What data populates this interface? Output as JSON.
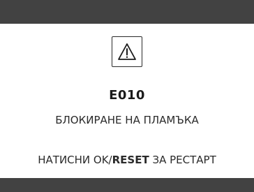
{
  "alert": {
    "icon": "warning-icon",
    "code": "E010",
    "message": "БЛОКИРАНЕ НА ПЛАМЪКА",
    "instruction": {
      "prefix": "НАТИСНИ OK/",
      "emphasis": "RESET",
      "suffix": " ЗА РЕСТАРТ"
    }
  },
  "colors": {
    "bar": "#424242",
    "background": "#ffffff",
    "text": "#2a2a2a"
  }
}
